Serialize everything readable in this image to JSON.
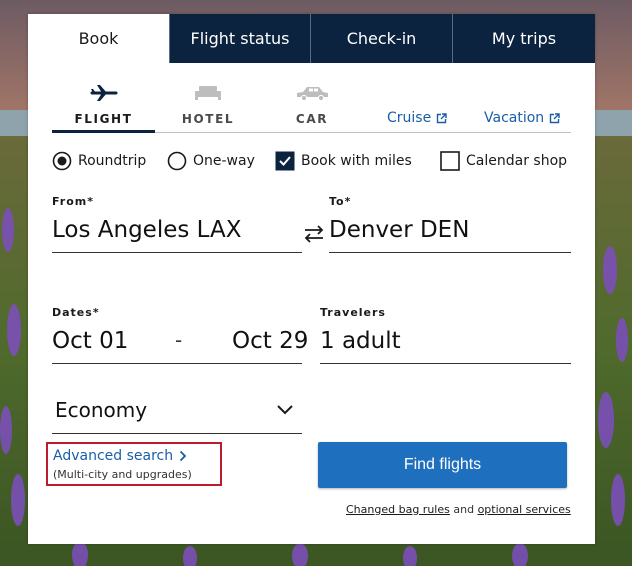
{
  "tabs": [
    {
      "label": "Book",
      "active": true
    },
    {
      "label": "Flight status",
      "active": false
    },
    {
      "label": "Check-in",
      "active": false
    },
    {
      "label": "My trips",
      "active": false
    }
  ],
  "products": {
    "flight": {
      "label": "FLIGHT",
      "icon": "airplane-icon",
      "selected": true
    },
    "hotel": {
      "label": "HOTEL",
      "icon": "hotel-bed-icon"
    },
    "car": {
      "label": "CAR",
      "icon": "car-icon"
    },
    "cruise": {
      "label": "Cruise",
      "icon": "external-link-icon"
    },
    "vacation": {
      "label": "Vacation",
      "icon": "external-link-icon"
    }
  },
  "options": {
    "roundtrip": {
      "label": "Roundtrip",
      "checked": true
    },
    "oneway": {
      "label": "One-way",
      "checked": false
    },
    "miles": {
      "label": "Book with miles",
      "checked": true
    },
    "calendar": {
      "label": "Calendar shop",
      "checked": false
    }
  },
  "fields": {
    "from": {
      "label": "From*",
      "value": "Los Angeles LAX"
    },
    "to": {
      "label": "To*",
      "value": "Denver DEN"
    },
    "dates": {
      "label": "Dates*",
      "depart": "Oct 01",
      "separator": "-",
      "return": "Oct 29"
    },
    "travelers": {
      "label": "Travelers",
      "value": "1 adult"
    },
    "cabin": {
      "value": "Economy"
    }
  },
  "advanced": {
    "link": "Advanced search",
    "sub": "(Multi-city and upgrades)"
  },
  "find_button": "Find flights",
  "bag_note": {
    "link1": "Changed bag rules",
    "and": "and",
    "link2": "optional services"
  },
  "colors": {
    "navy": "#0c2340",
    "link": "#1a5ea8",
    "button": "#1f6fbf",
    "highlight_box": "#b91c2b"
  }
}
